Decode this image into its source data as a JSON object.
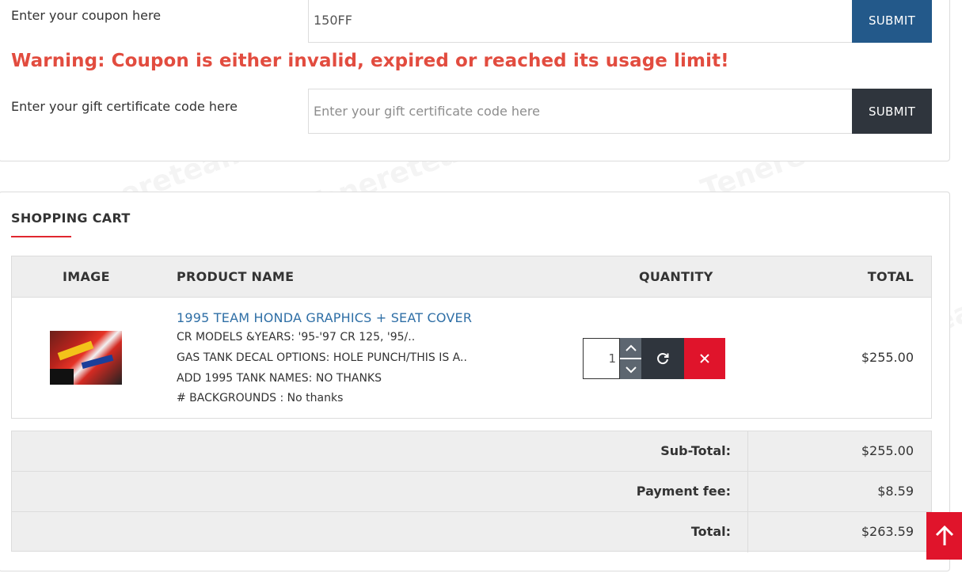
{
  "coupon": {
    "label": "Enter your coupon here",
    "value": "150FF",
    "submit_label": "SUBMIT"
  },
  "warning": "Warning: Coupon is either invalid, expired or reached its usage limit!",
  "gift": {
    "label": "Enter your gift certificate code here",
    "placeholder": "Enter your gift certificate code here",
    "submit_label": "SUBMIT"
  },
  "cart": {
    "title": "SHOPPING CART",
    "columns": [
      "IMAGE",
      "PRODUCT NAME",
      "QUANTITY",
      "TOTAL"
    ],
    "items": [
      {
        "name": "1995 TEAM HONDA GRAPHICS + SEAT COVER",
        "options": [
          "CR MODELS &YEARS: '95-'97 CR 125, '95/..",
          "GAS TANK DECAL OPTIONS: HOLE PUNCH/THIS IS A..",
          "ADD 1995 TANK NAMES: NO THANKS",
          "# BACKGROUNDS : No thanks"
        ],
        "quantity": "1",
        "total": "$255.00"
      }
    ]
  },
  "totals": [
    {
      "label": "Sub-Total:",
      "value": "$255.00"
    },
    {
      "label": "Payment fee:",
      "value": "$8.59"
    },
    {
      "label": "Total:",
      "value": "$263.59"
    }
  ],
  "watermark_text": "Tenereteam",
  "colors": {
    "submit_coupon": "#23598a",
    "submit_gift": "#2f353d",
    "warning": "#e24c3f",
    "accent_red": "#e0142b",
    "link": "#2f6fa6"
  },
  "icons": {
    "increment": "chevron-up-icon",
    "decrement": "chevron-down-icon",
    "refresh": "refresh-icon",
    "remove": "close-icon",
    "scroll_top": "arrow-up-icon"
  }
}
